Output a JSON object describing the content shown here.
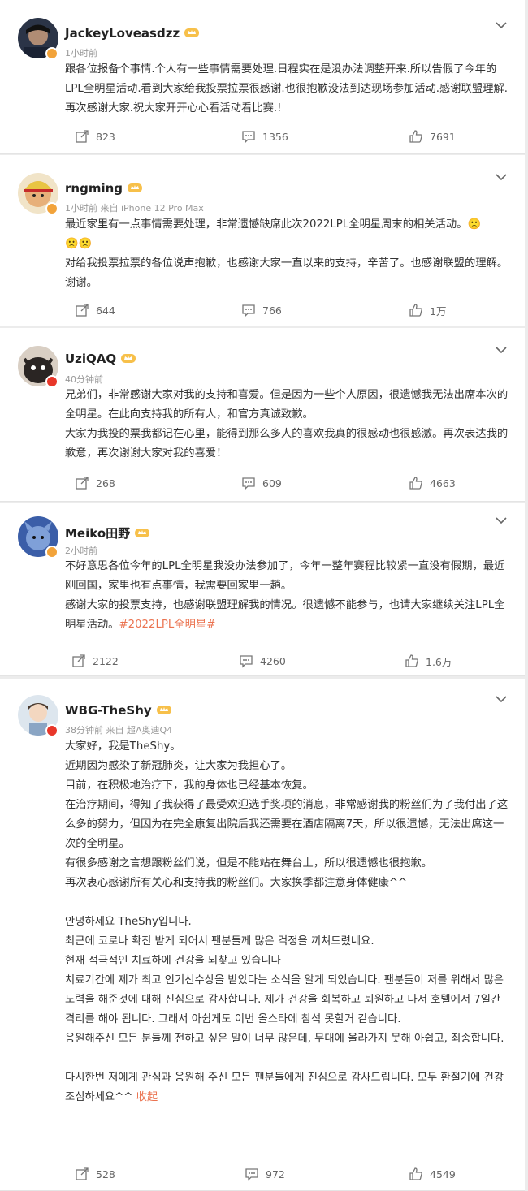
{
  "posts": [
    {
      "username": "JackeyLoveasdzz",
      "meta": "1小时前",
      "paragraphs": [
        "跟各位报备个事情.个人有一些事情需要处理.日程实在是没办法调整开来.所以告假了今年的LPL全明星活动.看到大家给我投票拉票很感谢.也很抱歉没法到达现场参加活动.感谢联盟理解.再次感谢大家.祝大家开开心心看活动看比赛.!"
      ],
      "shares": "823",
      "comments": "1356",
      "likes": "7691",
      "badge_color": "gold"
    },
    {
      "username": "rngming",
      "meta": "1小时前 来自 iPhone 12 Pro Max",
      "paragraphs": [
        "最近家里有一点事情需要处理，非常遗憾缺席此次2022LPL全明星周末的相关活动。🙁",
        "🙁🙁",
        "对给我投票拉票的各位说声抱歉，也感谢大家一直以来的支持，辛苦了。也感谢联盟的理解。谢谢。"
      ],
      "shares": "644",
      "comments": "766",
      "likes": "1万",
      "badge_color": "gold"
    },
    {
      "username": "UziQAQ",
      "meta": "40分钟前",
      "paragraphs": [
        "兄弟们，非常感谢大家对我的支持和喜爱。但是因为一些个人原因，很遗憾我无法出席本次的全明星。在此向支持我的所有人，和官方真诚致歉。",
        "大家为我投的票我都记在心里，能得到那么多人的喜欢我真的很感动也很感激。再次表达我的歉意，再次谢谢大家对我的喜爱！"
      ],
      "shares": "268",
      "comments": "609",
      "likes": "4663",
      "badge_color": "red"
    },
    {
      "username": "Meiko田野",
      "meta": "2小时前",
      "paragraphs": [
        "不好意思各位今年的LPL全明星我没办法参加了，今年一整年赛程比较紧一直没有假期，最近刚回国，家里也有点事情，我需要回家里一趟。",
        "感谢大家的投票支持，也感谢联盟理解我的情况。很遗憾不能参与，也请大家继续关注LPL全明星活动。"
      ],
      "hashtag": "#2022LPL全明星#",
      "shares": "2122",
      "comments": "4260",
      "likes": "1.6万",
      "badge_color": "gold"
    },
    {
      "username": "WBG-TheShy",
      "meta": "38分钟前 来自 超A奥迪Q4",
      "paragraphs": [
        "大家好，我是TheShy。",
        "近期因为感染了新冠肺炎，让大家为我担心了。",
        "目前，在积极地治疗下，我的身体也已经基本恢复。",
        "在治疗期间，得知了我获得了最受欢迎选手奖项的消息，非常感谢我的粉丝们为了我付出了这么多的努力，但因为在完全康复出院后我还需要在酒店隔离7天，所以很遗憾，无法出席这一次的全明星。",
        "有很多感谢之言想跟粉丝们说，但是不能站在舞台上，所以很遗憾也很抱歉。",
        "再次衷心感谢所有关心和支持我的粉丝们。大家换季都注意身体健康^^",
        "",
        "안녕하세요 TheShy입니다.",
        "최근에 코로나 확진 받게 되어서 팬분들께 많은 걱정을 끼쳐드렸네요.",
        "현재 적극적인 치료하에 건강을 되찾고 있습니다",
        "치료기간에 제가 최고 인기선수상을 받았다는 소식을 알게 되었습니다. 팬분들이 저를 위해서 많은 노력을 해준것에 대해 진심으로 감사합니다. 제가 건강을 회복하고 퇴원하고 나서 호텔에서 7일간 격리를 해야 됩니다. 그래서 아쉽게도 이번 올스타에 참석 못할거 같습니다.",
        "응원해주신 모든 분들께 전하고 싶은 말이 너무 많은데, 무대에 올라가지 못해 아쉽고, 죄송합니다.",
        "",
        "다시한번 저에게 관심과 응원해 주신 모든 팬분들에게 진심으로 감사드립니다. 모두 환절기에 건강 조심하세요^^"
      ],
      "collapse_label": "收起",
      "shares": "528",
      "comments": "972",
      "likes": "4549",
      "badge_color": "red"
    }
  ]
}
